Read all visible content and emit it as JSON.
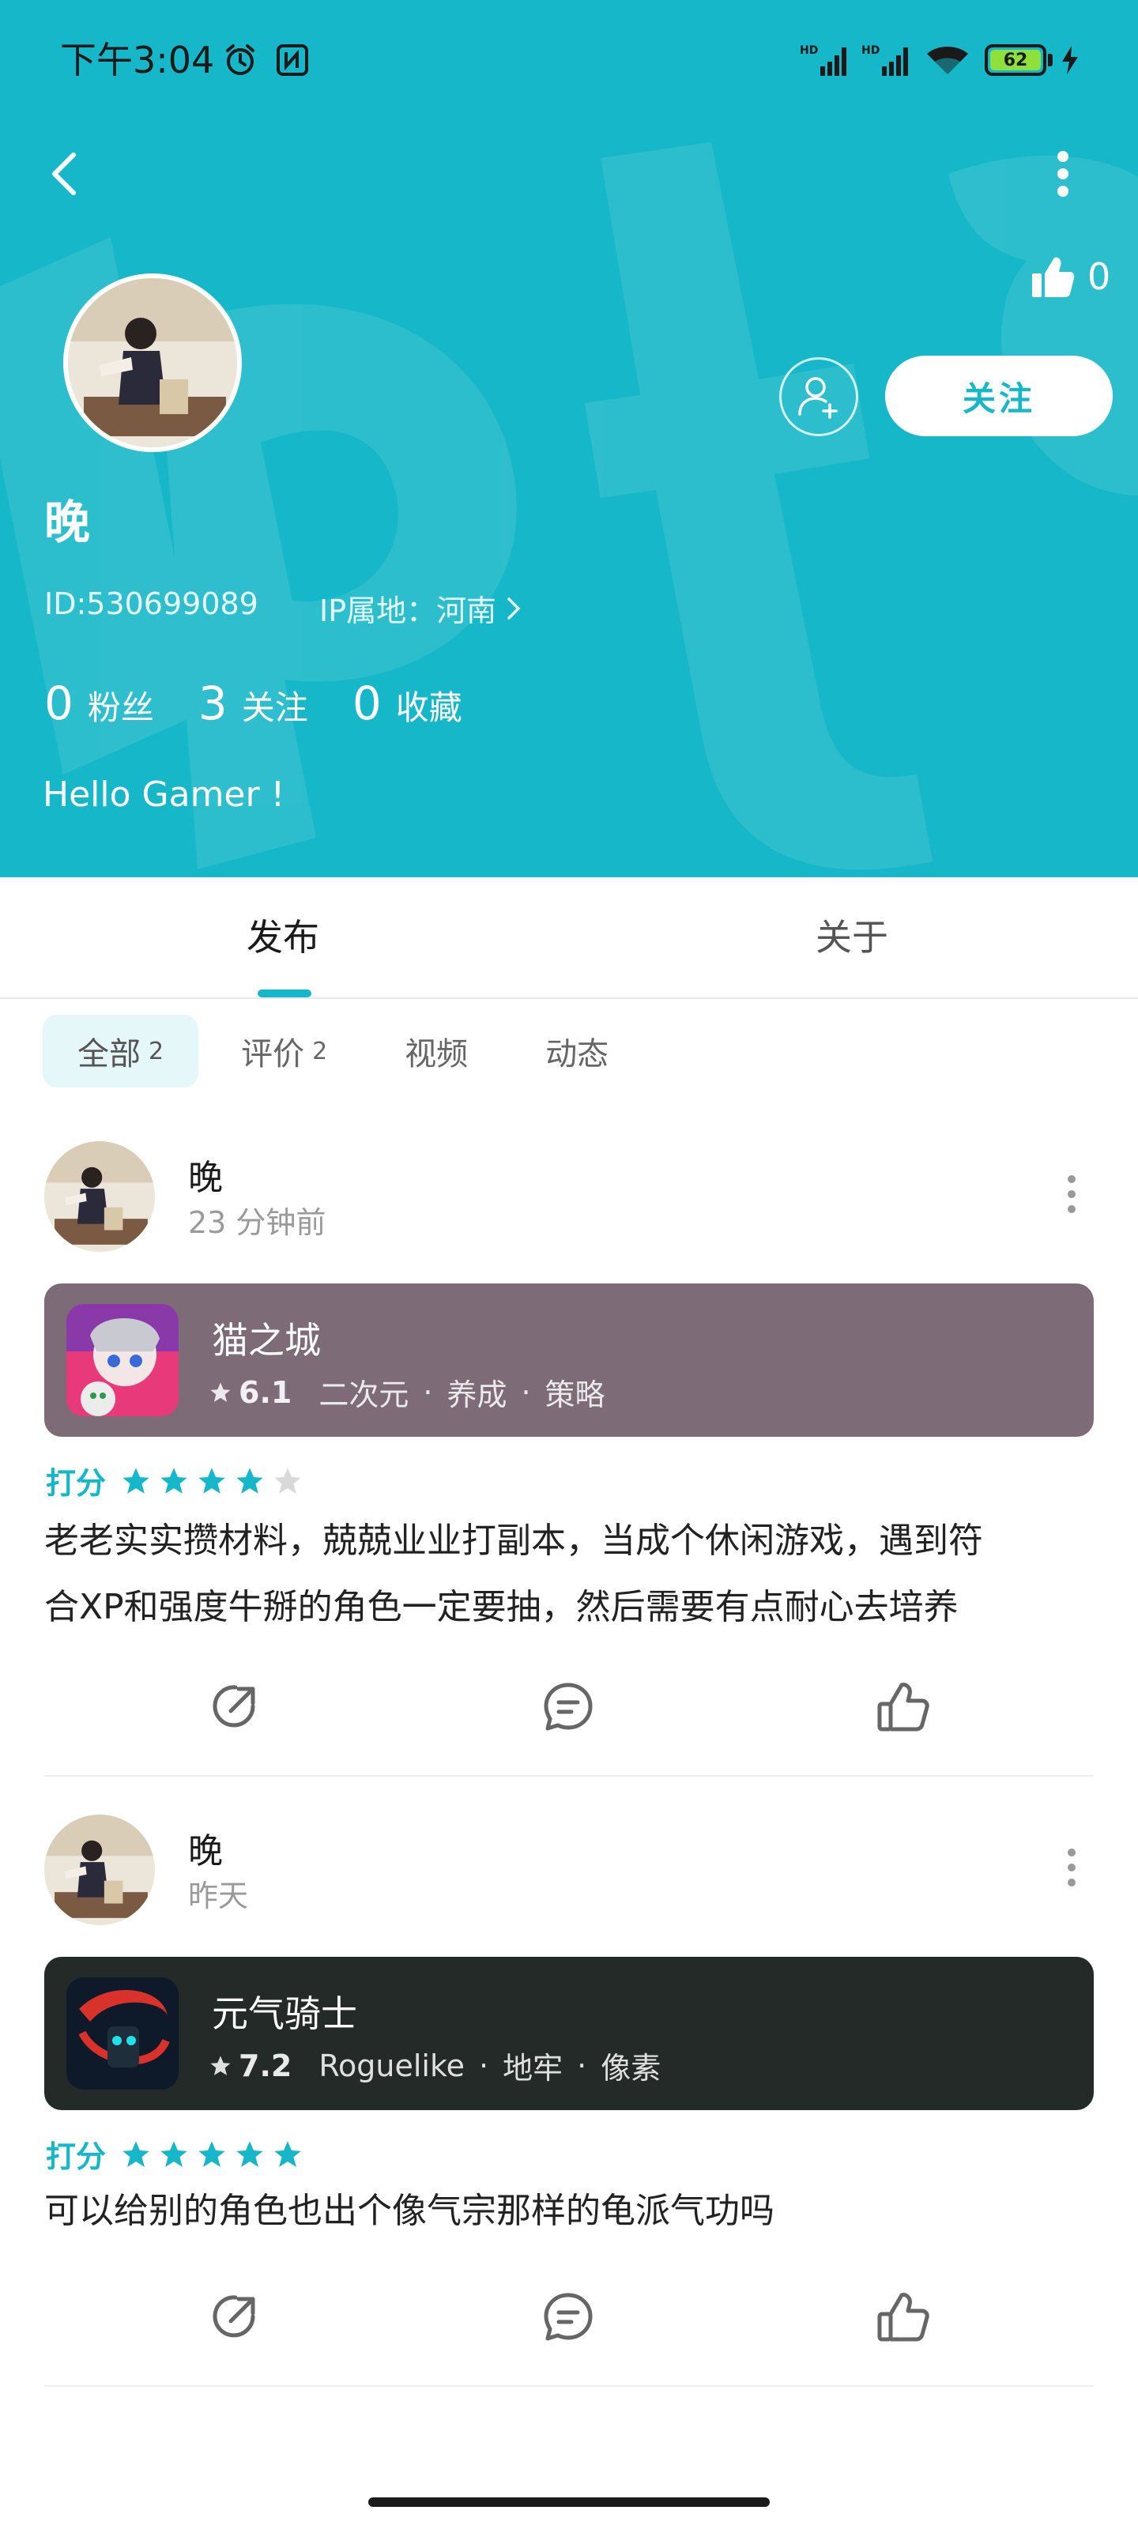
{
  "status_bar": {
    "time": "下午3:04",
    "battery_level": "62",
    "icons": [
      "alarm-icon",
      "nfc-icon",
      "hd-signal-icon",
      "hd-signal-icon",
      "wifi-icon",
      "battery-icon",
      "charging-icon"
    ]
  },
  "profile": {
    "like_count": "0",
    "follow_label": "关注",
    "name": "晚",
    "id_text": "ID:530699089",
    "ip_text": "IP属地：河南",
    "stats": [
      {
        "num": "0",
        "label": "粉丝"
      },
      {
        "num": "3",
        "label": "关注"
      },
      {
        "num": "0",
        "label": "收藏"
      }
    ],
    "bio": "Hello Gamer !"
  },
  "main_tabs": [
    "发布",
    "关于"
  ],
  "filter_chips": [
    {
      "label": "全部",
      "count": "2"
    },
    {
      "label": "评价",
      "count": "2"
    },
    {
      "label": "视频",
      "count": ""
    },
    {
      "label": "动态",
      "count": ""
    }
  ],
  "posts": [
    {
      "author": "晚",
      "time": "23 分钟前",
      "game": {
        "title": "猫之城",
        "score": "6.1",
        "tags": [
          "二次元",
          "养成",
          "策略"
        ],
        "card_color": "#7d6b78"
      },
      "rating_label": "打分",
      "stars": 4,
      "text_lines": [
        "老老实实攒材料，兢兢业业打副本，当成个休闲游戏，遇到符",
        "合XP和强度牛掰的角色一定要抽，然后需要有点耐心去培养"
      ]
    },
    {
      "author": "晚",
      "time": "昨天",
      "game": {
        "title": "元气骑士",
        "score": "7.2",
        "tags": [
          "Roguelike",
          "地牢",
          "像素"
        ],
        "card_color": "#242a28"
      },
      "rating_label": "打分",
      "stars": 5,
      "text_lines": [
        "可以给别的角色也出个像气宗那样的龟派气功吗"
      ]
    }
  ],
  "colors": {
    "accent": "#16b7c8",
    "star_on": "#16b7c8",
    "star_off": "#d9d9d9"
  }
}
